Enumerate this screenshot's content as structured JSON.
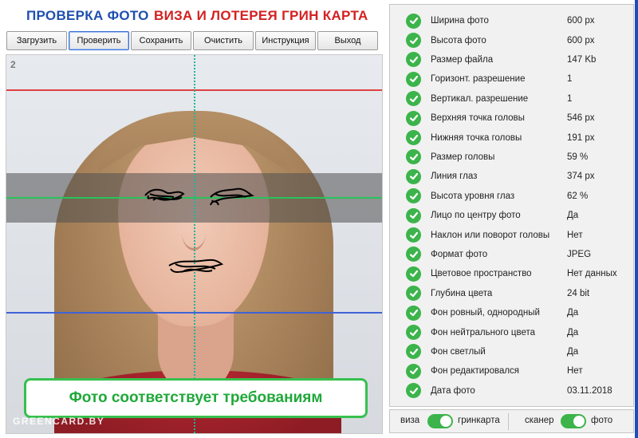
{
  "header": {
    "title_left": "ПРОВЕРКА ФОТО",
    "title_right": "ВИЗА И ЛОТЕРЕЯ ГРИН КАРТА"
  },
  "toolbar": {
    "buttons": [
      "Загрузить",
      "Проверить",
      "Сохранить",
      "Очистить",
      "Инструкция",
      "Выход"
    ]
  },
  "photo": {
    "number": "2",
    "status_message": "Фото соответствует требованиям",
    "watermark": "GREENCARD.BY"
  },
  "results": [
    {
      "label": "Ширина фото",
      "value": "600 px"
    },
    {
      "label": "Высота фото",
      "value": "600 px"
    },
    {
      "label": "Размер файла",
      "value": "147 Kb"
    },
    {
      "label": "Горизонт. разрешение",
      "value": "1"
    },
    {
      "label": "Вертикал. разрешение",
      "value": "1"
    },
    {
      "label": "Верхняя точка головы",
      "value": "546 px"
    },
    {
      "label": "Нижняя точка головы",
      "value": "191 px"
    },
    {
      "label": "Размер головы",
      "value": "59 %"
    },
    {
      "label": "Линия глаз",
      "value": "374 px"
    },
    {
      "label": "Высота уровня глаз",
      "value": "62 %"
    },
    {
      "label": "Лицо по центру фото",
      "value": "Да"
    },
    {
      "label": "Наклон или поворот головы",
      "value": "Нет"
    },
    {
      "label": "Формат фото",
      "value": "JPEG"
    },
    {
      "label": "Цветовое пространство",
      "value": "Нет данных"
    },
    {
      "label": "Глубина цвета",
      "value": "24 bit"
    },
    {
      "label": "Фон ровный, однородный",
      "value": "Да"
    },
    {
      "label": "Фон нейтрального цвета",
      "value": "Да"
    },
    {
      "label": "Фон светлый",
      "value": "Да"
    },
    {
      "label": "Фон редактировался",
      "value": "Нет"
    },
    {
      "label": "Дата фото",
      "value": "03.11.2018"
    }
  ],
  "toggles": {
    "left_off": "виза",
    "left_on": "гринкарта",
    "right_off": "сканер",
    "right_on": "фото"
  },
  "colors": {
    "title_blue": "#1f4fb0",
    "title_red": "#d42020",
    "success_green": "#3cb44b",
    "guide_red": "#e04040",
    "guide_green": "#27c35a",
    "guide_blue": "#3f63d8",
    "guide_teal": "#21b39b"
  }
}
